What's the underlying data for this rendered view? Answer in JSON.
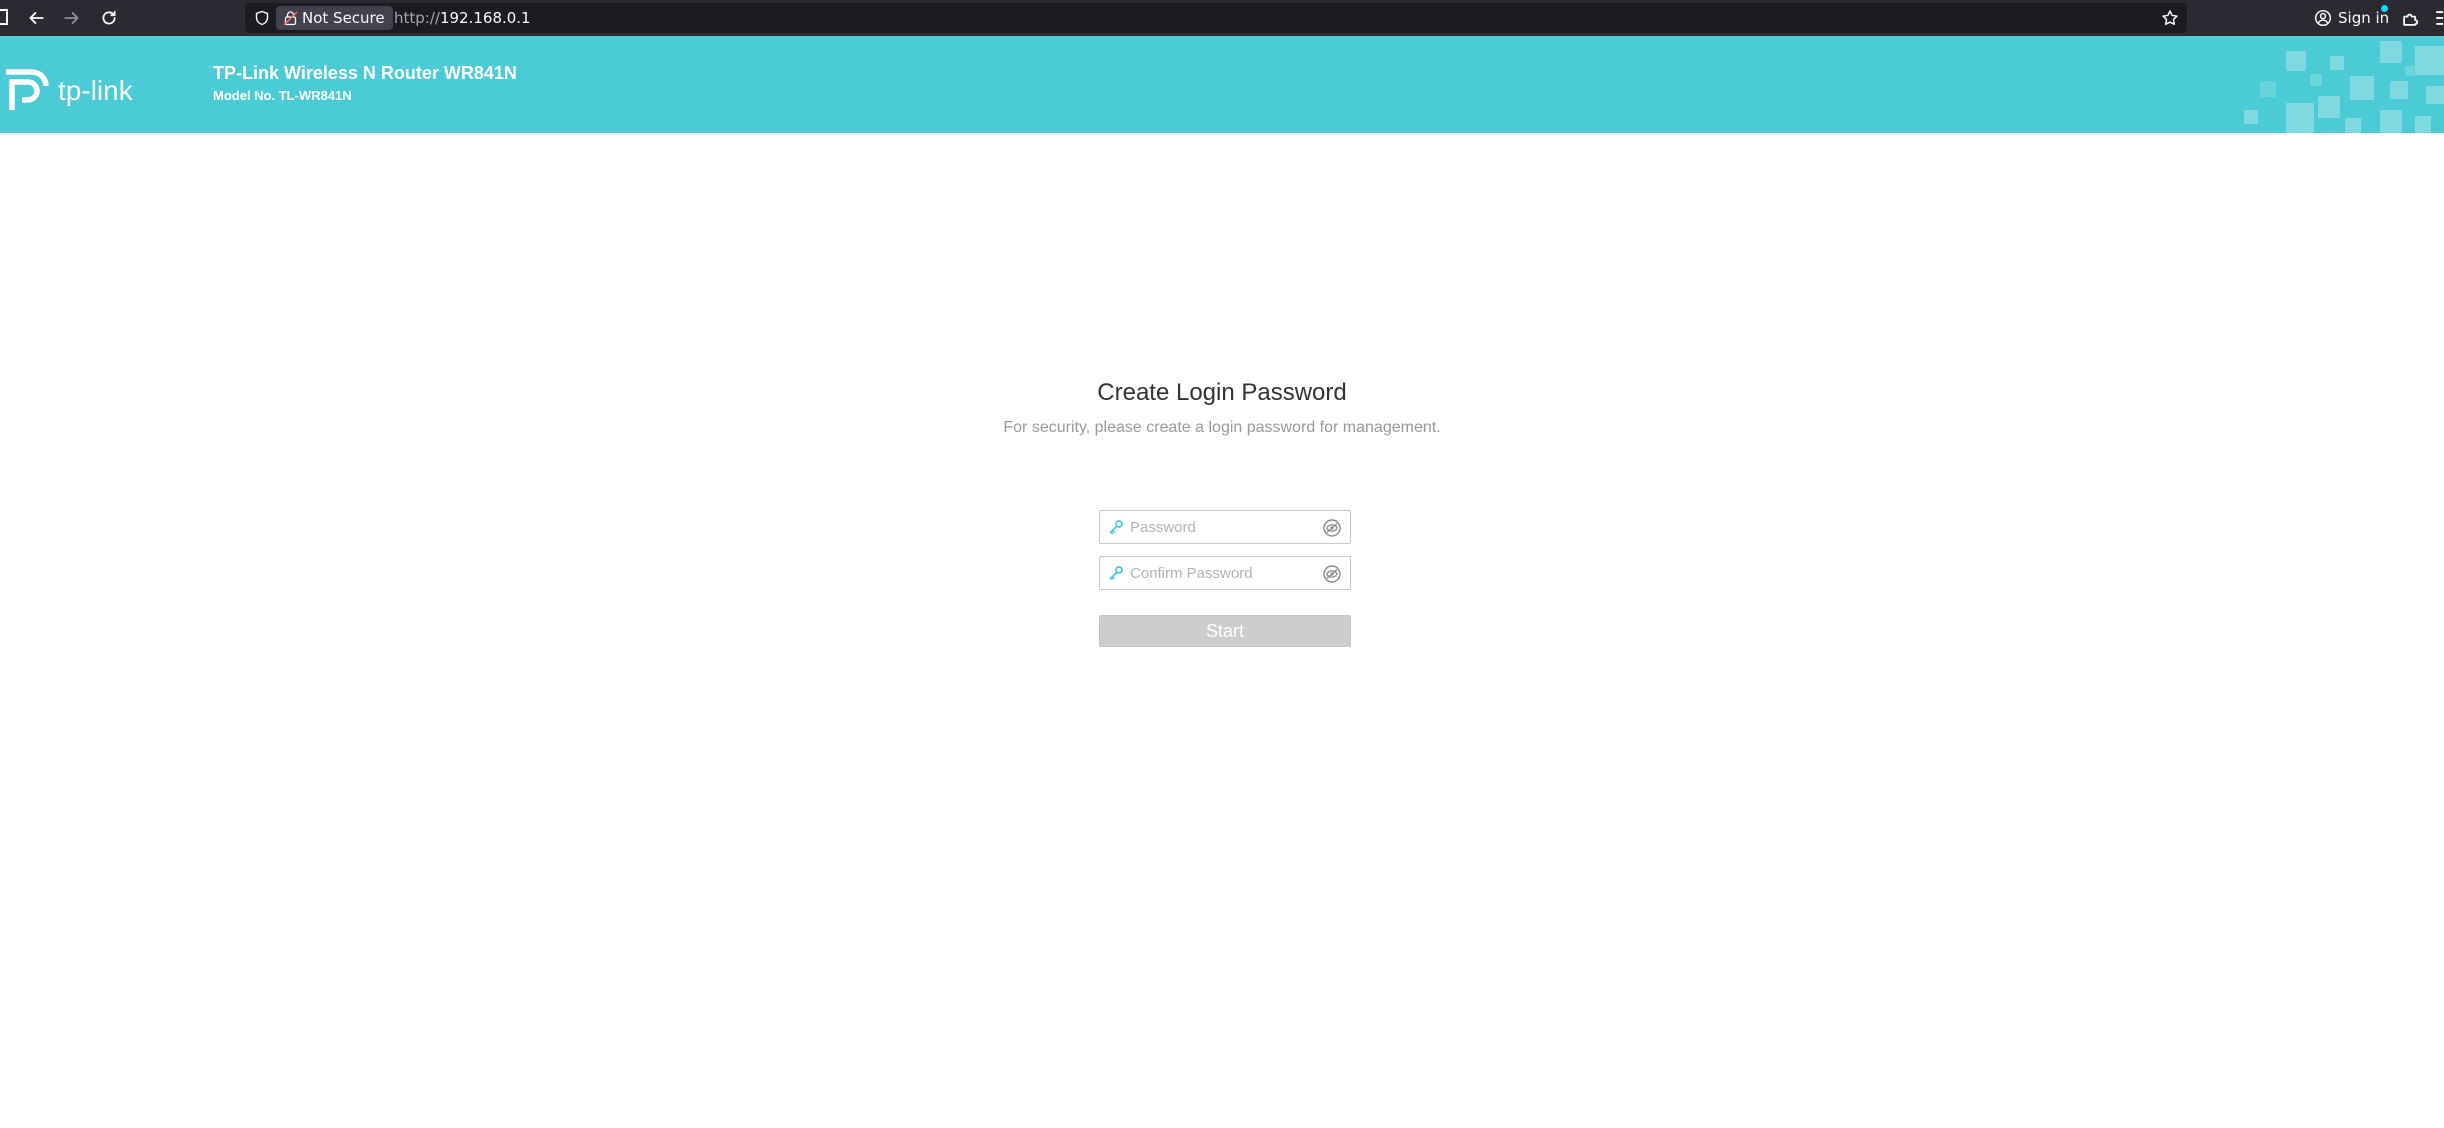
{
  "browser": {
    "security_label": "Not Secure",
    "url_protocol": "http://",
    "url_host": "192.168.0.1",
    "sign_in_label": "Sign in"
  },
  "header": {
    "brand": "tp-link",
    "title": "TP-Link Wireless N Router WR841N",
    "model": "Model No. TL-WR841N",
    "background_color": "#4acbd6"
  },
  "main": {
    "title": "Create Login Password",
    "subtitle": "For security, please create a login password for management.",
    "password_placeholder": "Password",
    "confirm_placeholder": "Confirm Password",
    "start_label": "Start"
  },
  "icons": {
    "field_icon": "key-icon",
    "reveal_icon": "eye-icon"
  }
}
